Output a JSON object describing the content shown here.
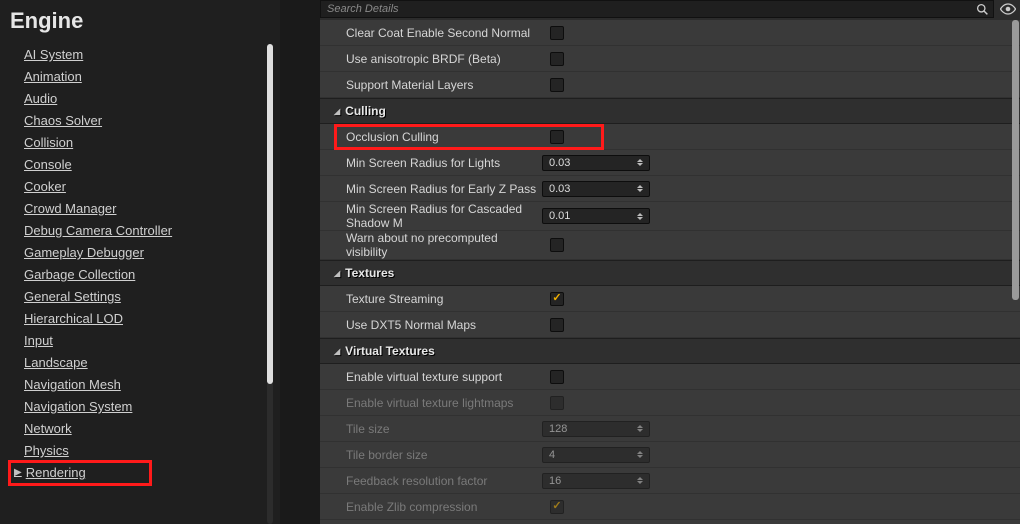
{
  "sidebar": {
    "title": "Engine",
    "items": [
      {
        "label": "AI System"
      },
      {
        "label": "Animation"
      },
      {
        "label": "Audio"
      },
      {
        "label": "Chaos Solver"
      },
      {
        "label": "Collision"
      },
      {
        "label": "Console"
      },
      {
        "label": "Cooker"
      },
      {
        "label": "Crowd Manager"
      },
      {
        "label": "Debug Camera Controller"
      },
      {
        "label": "Gameplay Debugger"
      },
      {
        "label": "Garbage Collection"
      },
      {
        "label": "General Settings"
      },
      {
        "label": "Hierarchical LOD"
      },
      {
        "label": "Input"
      },
      {
        "label": "Landscape"
      },
      {
        "label": "Navigation Mesh"
      },
      {
        "label": "Navigation System"
      },
      {
        "label": "Network"
      },
      {
        "label": "Physics"
      },
      {
        "label": "Rendering",
        "active": true,
        "highlighted": true
      }
    ]
  },
  "search": {
    "placeholder": "Search Details"
  },
  "sections": [
    {
      "title": "",
      "headerless": true,
      "rows": [
        {
          "label": "Clear Coat Enable Second Normal",
          "type": "checkbox",
          "checked": false
        },
        {
          "label": "Use anisotropic BRDF (Beta)",
          "type": "checkbox",
          "checked": false
        },
        {
          "label": "Support Material Layers",
          "type": "checkbox",
          "checked": false
        }
      ]
    },
    {
      "title": "Culling",
      "rows": [
        {
          "label": "Occlusion Culling",
          "type": "checkbox",
          "checked": false,
          "highlighted": true
        },
        {
          "label": "Min Screen Radius for Lights",
          "type": "spin",
          "value": "0.03"
        },
        {
          "label": "Min Screen Radius for Early Z Pass",
          "type": "spin",
          "value": "0.03"
        },
        {
          "label": "Min Screen Radius for Cascaded Shadow M",
          "type": "spin",
          "value": "0.01"
        },
        {
          "label": "Warn about no precomputed visibility",
          "type": "checkbox",
          "checked": false
        }
      ]
    },
    {
      "title": "Textures",
      "rows": [
        {
          "label": "Texture Streaming",
          "type": "checkbox",
          "checked": true
        },
        {
          "label": "Use DXT5 Normal Maps",
          "type": "checkbox",
          "checked": false
        }
      ]
    },
    {
      "title": "Virtual Textures",
      "rows": [
        {
          "label": "Enable virtual texture support",
          "type": "checkbox",
          "checked": false
        },
        {
          "label": "Enable virtual texture lightmaps",
          "type": "checkbox",
          "checked": false,
          "disabled": true
        },
        {
          "label": "Tile size",
          "type": "spin",
          "value": "128",
          "disabled": true
        },
        {
          "label": "Tile border size",
          "type": "spin",
          "value": "4",
          "disabled": true
        },
        {
          "label": "Feedback resolution factor",
          "type": "spin",
          "value": "16",
          "disabled": true
        },
        {
          "label": "Enable Zlib compression",
          "type": "checkbox",
          "checked": true,
          "disabled": true
        }
      ]
    }
  ]
}
